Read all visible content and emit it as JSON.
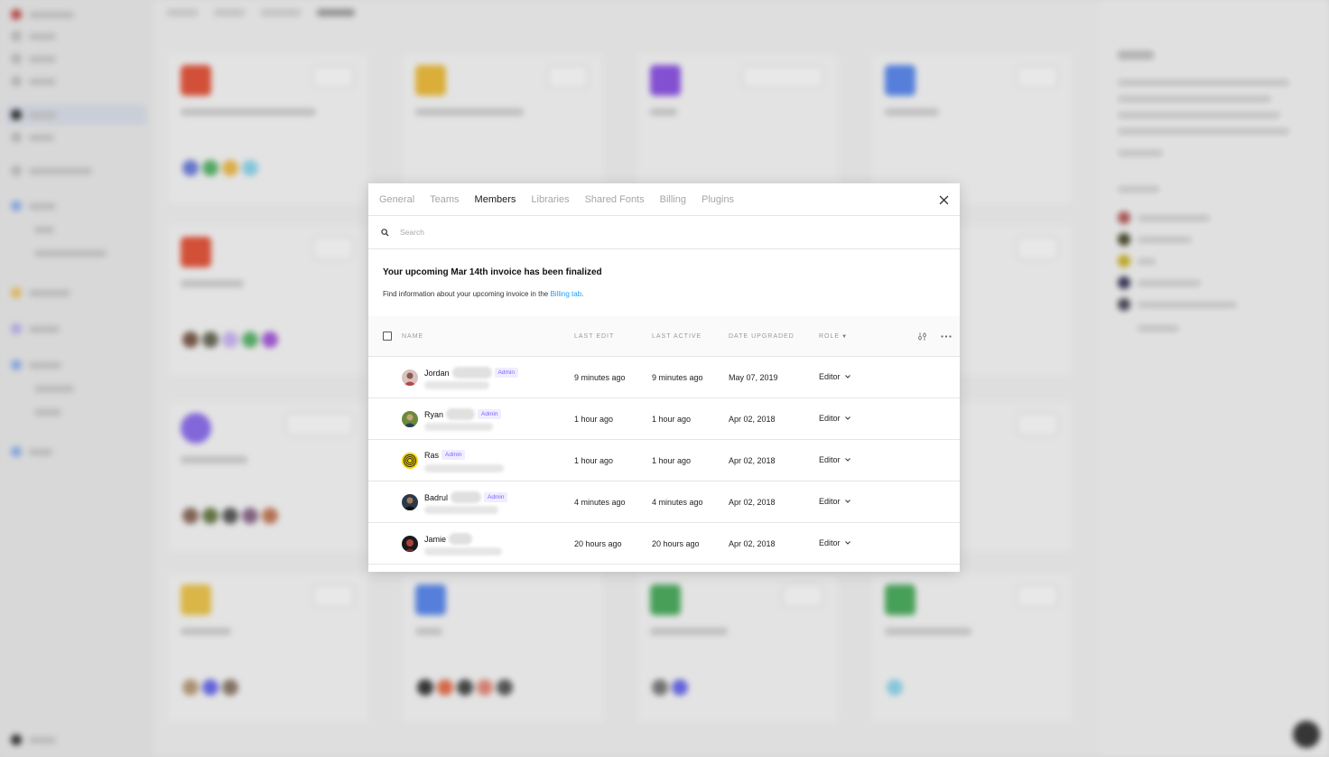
{
  "settings_modal": {
    "tabs": [
      {
        "label": "General"
      },
      {
        "label": "Teams"
      },
      {
        "label": "Members"
      },
      {
        "label": "Libraries"
      },
      {
        "label": "Shared Fonts"
      },
      {
        "label": "Billing"
      },
      {
        "label": "Plugins"
      }
    ],
    "active_tab": "Members",
    "search": {
      "placeholder": "Search",
      "value": ""
    },
    "notice": {
      "title": "Your upcoming Mar 14th invoice has been finalized",
      "body": "Find information about your upcoming invoice in the ",
      "link": "Billing tab",
      "suffix": "."
    },
    "table": {
      "headers": {
        "name": "NAME",
        "last_edit": "LAST EDIT",
        "last_active": "LAST ACTIVE",
        "date_upgraded": "DATE UPGRADED",
        "role": "ROLE"
      },
      "rows": [
        {
          "name": "Jordan",
          "badge": "Admin",
          "last_edit": "9 minutes ago",
          "last_active": "9 minutes ago",
          "date_upgraded": "May 07, 2019",
          "role": "Editor"
        },
        {
          "name": "Ryan",
          "badge": "Admin",
          "last_edit": "1 hour ago",
          "last_active": "1 hour ago",
          "date_upgraded": "Apr 02, 2018",
          "role": "Editor"
        },
        {
          "name": "Ras",
          "badge": "Admin",
          "last_edit": "1 hour ago",
          "last_active": "1 hour ago",
          "date_upgraded": "Apr 02, 2018",
          "role": "Editor"
        },
        {
          "name": "Badrul",
          "badge": "Admin",
          "last_edit": "4 minutes ago",
          "last_active": "4 minutes ago",
          "date_upgraded": "Apr 02, 2018",
          "role": "Editor"
        },
        {
          "name": "Jamie",
          "badge": "",
          "last_edit": "20 hours ago",
          "last_active": "20 hours ago",
          "date_upgraded": "Apr 02, 2018",
          "role": "Editor"
        }
      ]
    }
  },
  "colors": {
    "accent_link": "#18a0fb",
    "admin_badge_text": "#7b61ff",
    "admin_badge_bg": "#efedff"
  },
  "icons": [
    "search-icon",
    "close-icon",
    "filter-settings-icon",
    "more-options-icon",
    "chevron-down-icon"
  ]
}
